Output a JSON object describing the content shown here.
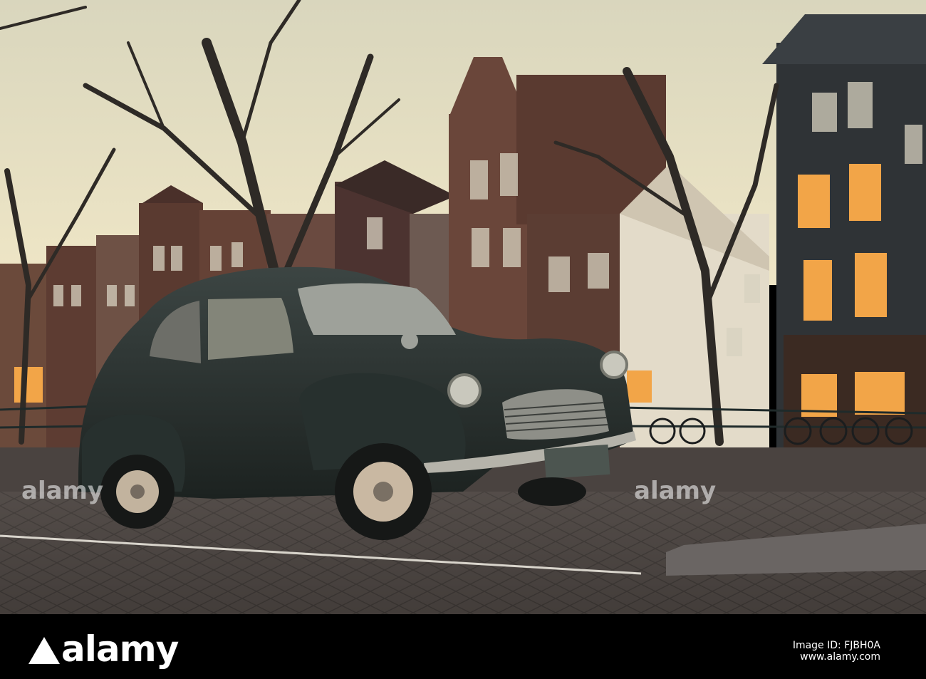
{
  "photo": {
    "watermark_text": "alamy",
    "license_plate_text": "",
    "colors": {
      "sky": "#e8e2c8",
      "car_body": "#2b322f",
      "cobblestone": "#4a4542",
      "brick_building": "#5a3a30",
      "dark_building": "#2f3336",
      "lit_window": "#f2a548"
    }
  },
  "footer": {
    "brand": "alamy",
    "image_id_line1": "Image ID: FJBH0A",
    "image_id_line2": "www.alamy.com"
  }
}
